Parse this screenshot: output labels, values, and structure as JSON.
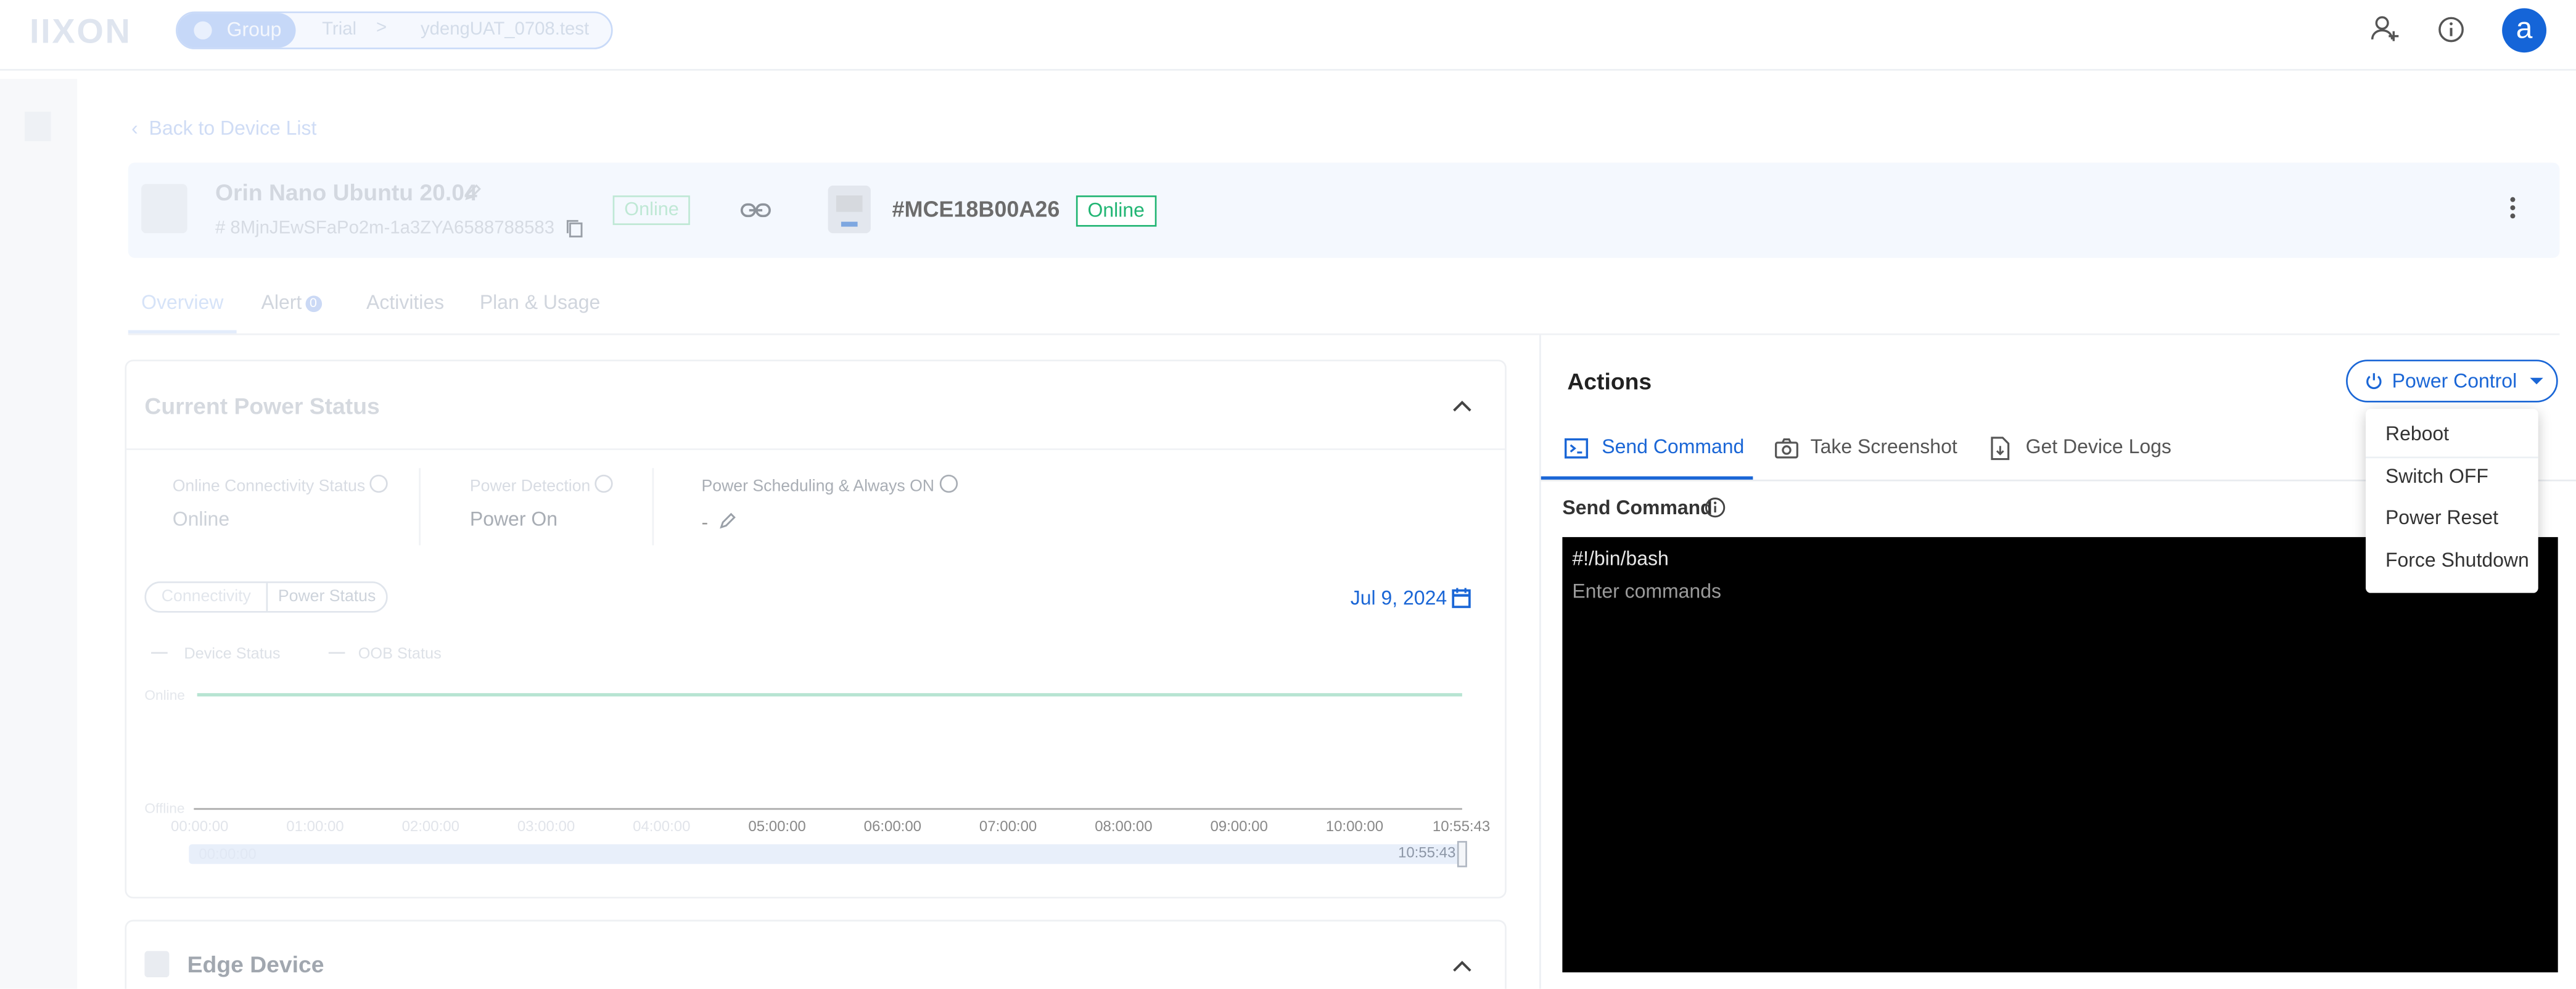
{
  "topbar": {
    "logo": "IIXON",
    "breadcrumb": {
      "group": "Group",
      "middle": "Trial",
      "current": "ydengUAT_0708.test"
    },
    "avatar_letter": "a",
    "icons": [
      "add-user-icon",
      "info-icon"
    ]
  },
  "header": {
    "back_link": "Back to Device List",
    "device_name": "Orin Nano Ubuntu 20.04",
    "device_id": "# 8MjnJEwSFaPo2m-1a3ZYA6588788583",
    "device_status": "Online",
    "edge_id": "#MCE18B00A26",
    "edge_status": "Online"
  },
  "tabs": [
    {
      "label": "Overview",
      "active": true
    },
    {
      "label": "Alert",
      "badge": "0"
    },
    {
      "label": "Activities"
    },
    {
      "label": "Plan & Usage"
    }
  ],
  "power_status": {
    "title": "Current Power Status",
    "stats": [
      {
        "label": "Online Connectivity Status",
        "value": "Online"
      },
      {
        "label": "Power Detection",
        "value": "Power On"
      },
      {
        "label": "Power Scheduling & Always ON",
        "value": "-"
      }
    ],
    "segments": [
      "Connectivity",
      "Power Status"
    ],
    "date": "Jul 9, 2024",
    "legend": [
      "Device Status",
      "OOB Status"
    ],
    "y_labels": [
      "Online",
      "Offline"
    ],
    "x_ticks": [
      "00:00:00",
      "01:00:00",
      "02:00:00",
      "03:00:00",
      "04:00:00",
      "05:00:00",
      "06:00:00",
      "07:00:00",
      "08:00:00",
      "09:00:00",
      "10:00:00",
      "10:55:43"
    ],
    "scroll_start": "00:00:00",
    "scroll_end": "10:55:43"
  },
  "edge_card": {
    "title": "Edge Device"
  },
  "actions": {
    "title": "Actions",
    "power_control_label": "Power Control",
    "tabs": [
      {
        "label": "Send Command",
        "active": true
      },
      {
        "label": "Take Screenshot"
      },
      {
        "label": "Get Device Logs"
      }
    ],
    "send_label": "Send Command",
    "terminal_first_line": "#!/bin/bash",
    "terminal_placeholder": "Enter commands",
    "dropdown": [
      "Reboot",
      "Switch OFF",
      "Power Reset",
      "Force Shutdown"
    ]
  },
  "colors": {
    "accent": "#1a66d6",
    "online": "#21b573",
    "terminal_bg": "#000000"
  }
}
